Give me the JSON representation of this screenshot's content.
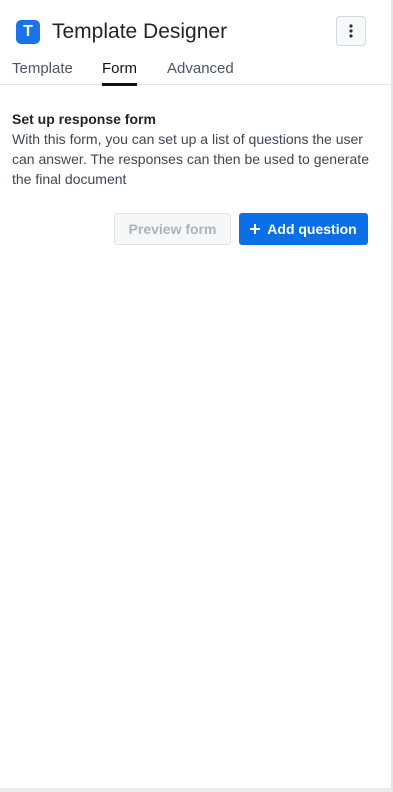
{
  "app": {
    "logo_letter": "T",
    "title": "Template Designer",
    "menu_icon": "more-vertical-icon"
  },
  "tabs": [
    {
      "label": "Template",
      "active": false
    },
    {
      "label": "Form",
      "active": true
    },
    {
      "label": "Advanced",
      "active": false
    }
  ],
  "form_section": {
    "title": "Set up response form",
    "description": "With this form, you can set up a list of questions the user can answer. The responses can then be used to generate the final document"
  },
  "actions": {
    "preview_label": "Preview form",
    "preview_disabled": true,
    "add_label": "Add question",
    "add_icon": "plus-icon"
  },
  "colors": {
    "accent": "#0b6fe8",
    "logo": "#1a73e8",
    "disabled_text": "#aab3bd"
  }
}
